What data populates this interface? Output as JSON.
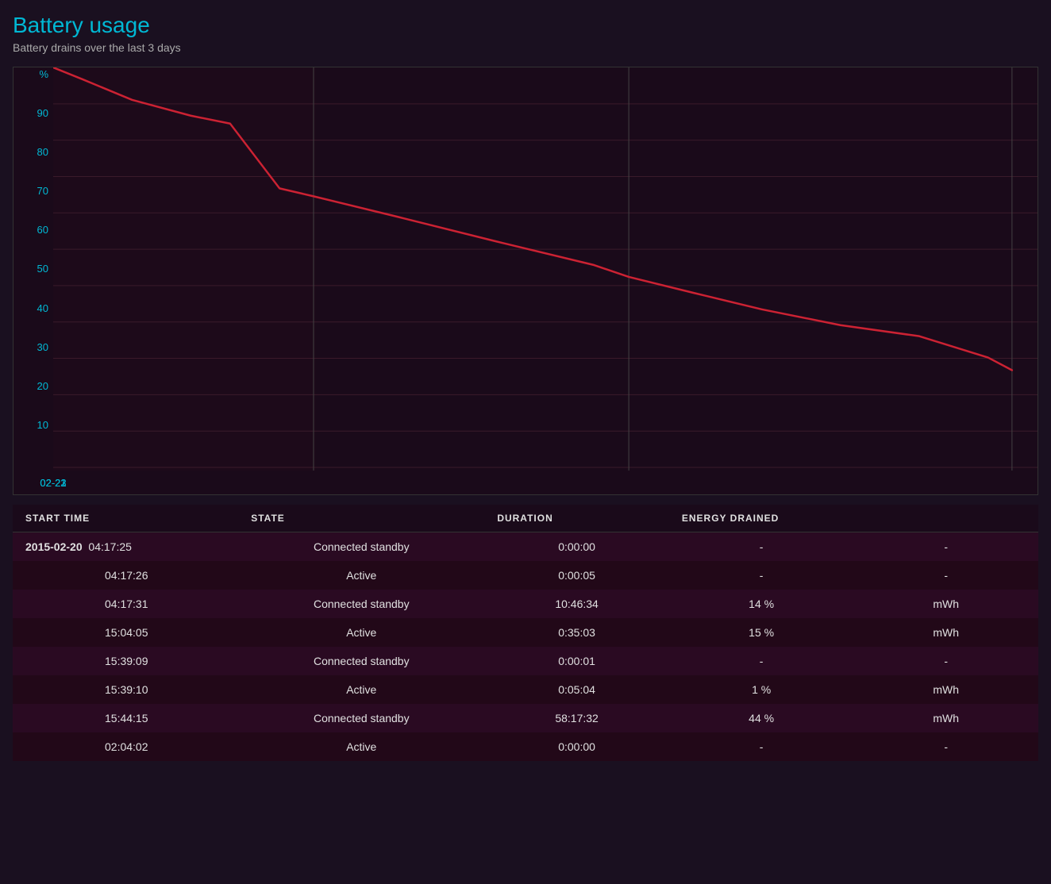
{
  "title": "Battery usage",
  "subtitle": "Battery drains over the last 3 days",
  "chart": {
    "y_axis_label": "%",
    "y_labels": [
      "",
      "10",
      "20",
      "30",
      "40",
      "50",
      "60",
      "70",
      "80",
      "90",
      ""
    ],
    "x_labels": [
      {
        "label": "02-21",
        "pct": 26.5
      },
      {
        "label": "02-22",
        "pct": 58.5
      },
      {
        "label": "02-23",
        "pct": 97.5
      }
    ],
    "line_color": "#cc2233",
    "grid_color": "#3a1a2a",
    "vline_color": "#3a1a2a",
    "points": [
      [
        0,
        100
      ],
      [
        3,
        97
      ],
      [
        8,
        92
      ],
      [
        14,
        88
      ],
      [
        18,
        86
      ],
      [
        23,
        70
      ],
      [
        26.5,
        68
      ],
      [
        35,
        63
      ],
      [
        45,
        57
      ],
      [
        55,
        51
      ],
      [
        58.5,
        48
      ],
      [
        65,
        44
      ],
      [
        72,
        40
      ],
      [
        80,
        36
      ],
      [
        88,
        33
      ],
      [
        95,
        28
      ],
      [
        97.5,
        26
      ]
    ]
  },
  "table": {
    "headers": [
      "START TIME",
      "STATE",
      "DURATION",
      "ENERGY DRAINED",
      ""
    ],
    "rows": [
      {
        "date": "2015-02-20",
        "time": "04:17:25",
        "state": "Connected standby",
        "duration": "0:00:00",
        "energy1": "-",
        "energy2": "-"
      },
      {
        "date": "",
        "time": "04:17:26",
        "state": "Active",
        "duration": "0:00:05",
        "energy1": "-",
        "energy2": "-"
      },
      {
        "date": "",
        "time": "04:17:31",
        "state": "Connected standby",
        "duration": "10:46:34",
        "energy1": "14 %",
        "energy2": "mWh"
      },
      {
        "date": "",
        "time": "15:04:05",
        "state": "Active",
        "duration": "0:35:03",
        "energy1": "15 %",
        "energy2": "mWh"
      },
      {
        "date": "",
        "time": "15:39:09",
        "state": "Connected standby",
        "duration": "0:00:01",
        "energy1": "-",
        "energy2": "-"
      },
      {
        "date": "",
        "time": "15:39:10",
        "state": "Active",
        "duration": "0:05:04",
        "energy1": "1 %",
        "energy2": "mWh"
      },
      {
        "date": "",
        "time": "15:44:15",
        "state": "Connected standby",
        "duration": "58:17:32",
        "energy1": "44 %",
        "energy2": "mWh"
      },
      {
        "date": "",
        "time": "02:04:02",
        "state": "Active",
        "duration": "0:00:00",
        "energy1": "-",
        "energy2": "-"
      }
    ]
  }
}
